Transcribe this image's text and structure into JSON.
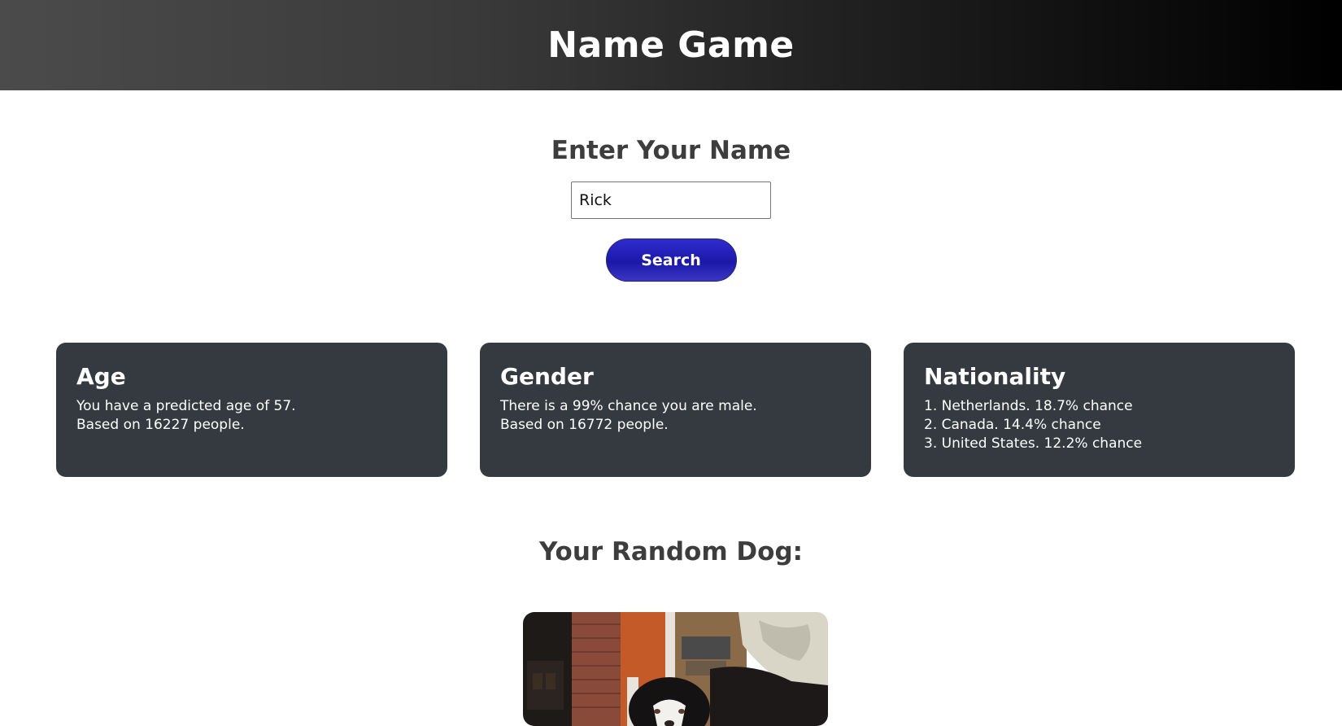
{
  "header": {
    "title": "Name Game"
  },
  "form": {
    "heading": "Enter Your Name",
    "name_value": "Rick",
    "search_label": "Search"
  },
  "cards": [
    {
      "title": "Age",
      "lines": [
        "You have a predicted age of 57.",
        "Based on 16227 people."
      ]
    },
    {
      "title": "Gender",
      "lines": [
        "There is a 99% chance you are male.",
        "Based on 16772 people."
      ]
    },
    {
      "title": "Nationality",
      "lines": [
        "1. Netherlands. 18.7% chance",
        "2. Canada. 14.4% chance",
        "3. United States. 12.2% chance"
      ]
    }
  ],
  "dog": {
    "title": "Your Random Dog:"
  },
  "colors": {
    "card_bg": "#343a40",
    "button_primary": "#1b18a8",
    "header_dark": "#000000"
  }
}
